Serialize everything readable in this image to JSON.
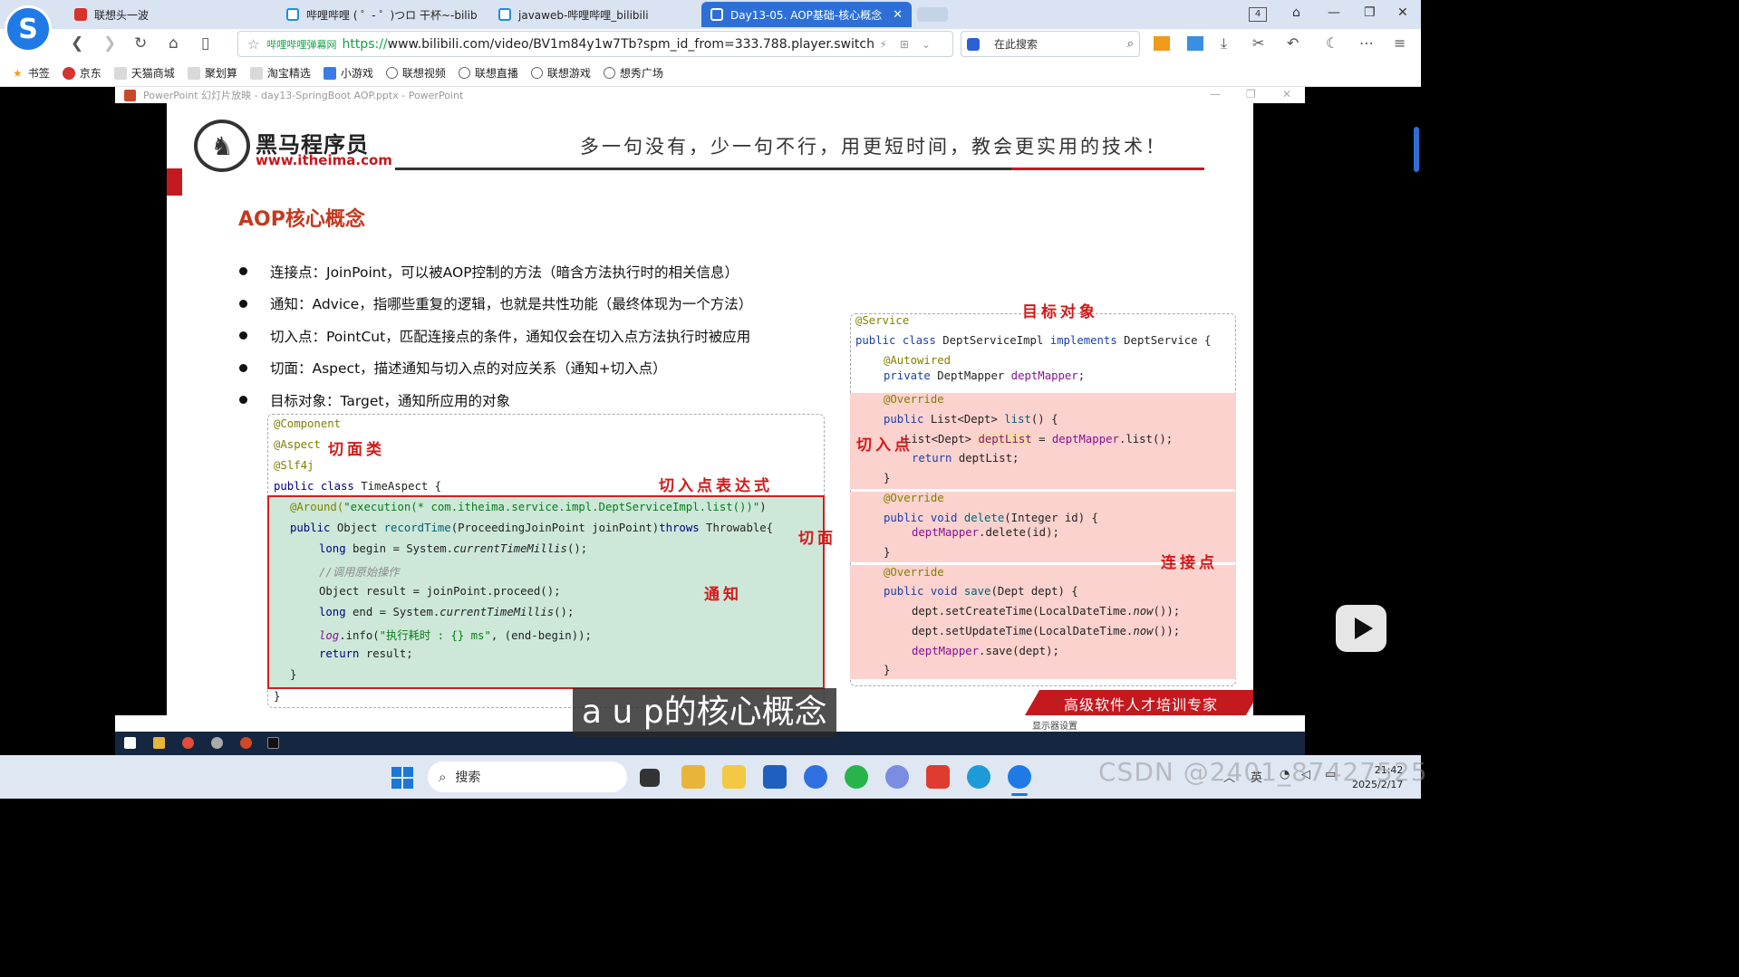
{
  "browser": {
    "tabs": [
      {
        "label": "联想头一波"
      },
      {
        "label": "哔哩哔哩 ( ゜- ゜)つロ 干杯~-bilib"
      },
      {
        "label": "javaweb-哔哩哔哩_bilibili"
      },
      {
        "label": "Day13-05. AOP基础-核心概念"
      }
    ],
    "tab_count": "4",
    "address": {
      "site_label": "哔哩哔哩弹幕网",
      "url_scheme": "https://",
      "url_rest": "www.bilibili.com/video/BV1m84y1w7Tb?spm_id_from=333.788.player.switch"
    },
    "search_placeholder": "在此搜索",
    "bookmarks": [
      "书签",
      "京东",
      "天猫商城",
      "聚划算",
      "淘宝精选",
      "小游戏",
      "联想视频",
      "联想直播",
      "联想游戏",
      "想秀广场"
    ]
  },
  "ppt": {
    "window_title": "PowerPoint 幻灯片放映 - day13-SpringBoot AOP.pptx - PowerPoint",
    "status_text": "显示器设置"
  },
  "slide": {
    "brand_name": "黑马程序员",
    "brand_url": "www.itheima.com",
    "slogan": "多一句没有，少一句不行，用更短时间，教会更实用的技术！",
    "title": "AOP核心概念",
    "bullets": [
      "连接点：JoinPoint，可以被AOP控制的方法（暗含方法执行时的相关信息）",
      "通知：Advice，指哪些重复的逻辑，也就是共性功能（最终体现为一个方法）",
      "切入点：PointCut，匹配连接点的条件，通知仅会在切入点方法执行时被应用",
      "切面：Aspect，描述通知与切入点的对应关系（通知+切入点）",
      "目标对象：Target，通知所应用的对象"
    ],
    "left_code": {
      "line1": "@Component",
      "line2": "@Aspect",
      "line3": "@Slf4j",
      "line4_kw": "public class",
      "line4_rest": " TimeAspect {",
      "line5_ann": "@Around(",
      "line5_str": "\"execution(* com.itheima.service.impl.DeptServiceImpl.list())\"",
      "line5_end": ")",
      "line6_kw": "public",
      "line6_a": " Object ",
      "line6_fn": "recordTime",
      "line6_b": "(ProceedingJoinPoint joinPoint)",
      "line6_kw2": "throws",
      "line6_c": " Throwable{",
      "line7_kw": "long",
      "line7_a": " begin = System.",
      "line7_it": "currentTimeMillis",
      "line7_b": "();",
      "line8": "//调用原始操作",
      "line9": "Object result = joinPoint.proceed();",
      "line10_kw": "long",
      "line10_a": " end = System.",
      "line10_it": "currentTimeMillis",
      "line10_b": "();",
      "line11_it": "log",
      "line11_a": ".info(",
      "line11_str": "\"执行耗时 : {} ms\"",
      "line11_b": ", (end-begin));",
      "line12_kw": "return",
      "line12_a": " result;",
      "line13": "}",
      "line14": "}"
    },
    "right_code": {
      "r1": "@Service",
      "r2_kw": "public class",
      "r2_a": " DeptServiceImpl ",
      "r2_kw2": "implements",
      "r2_b": " DeptService {",
      "r3": "@Autowired",
      "r4_kw": "private",
      "r4_a": " DeptMapper ",
      "r4_fld": "deptMapper",
      "r4_b": ";",
      "r5": "@Override",
      "r6_kw": "public",
      "r6_a": " List<Dept> ",
      "r6_fn": "list",
      "r6_b": "() {",
      "r7_a": "List<Dept> ",
      "r7_hl": "deptList",
      "r7_b": " = ",
      "r7_fld": "deptMapper",
      "r7_c": ".list();",
      "r8_kw": "return",
      "r8_a": " deptList;",
      "r9": "}",
      "r10": "@Override",
      "r11_kw": "public void",
      "r11_fn": " delete",
      "r11_a": "(Integer id) {",
      "r12_fld": "deptMapper",
      "r12_a": ".delete(id);",
      "r13": "}",
      "r14": "@Override",
      "r15_kw": "public void",
      "r15_fn": " save",
      "r15_a": "(Dept dept) {",
      "r16_a": "dept.setCreateTime(LocalDateTime.",
      "r16_it": "now",
      "r16_b": "());",
      "r17_a": "dept.setUpdateTime(LocalDateTime.",
      "r17_it": "now",
      "r17_b": "());",
      "r18_fld": "deptMapper",
      "r18_a": ".save(dept);",
      "r19": "}"
    },
    "annotations": {
      "aspect_class": "切面类",
      "pointcut_expr": "切入点表达式",
      "aspect": "切面",
      "advice": "通知",
      "target": "目标对象",
      "pointcut": "切入点",
      "joinpoint": "连接点"
    },
    "banner": "高级软件人才培训专家"
  },
  "subtitle": "a u p的核心概念",
  "taskbar": {
    "search_label": "搜索",
    "tray_lang": "英",
    "time": "21:42",
    "date": "2025/2/17"
  },
  "watermark": "CSDN @2401_87427525"
}
